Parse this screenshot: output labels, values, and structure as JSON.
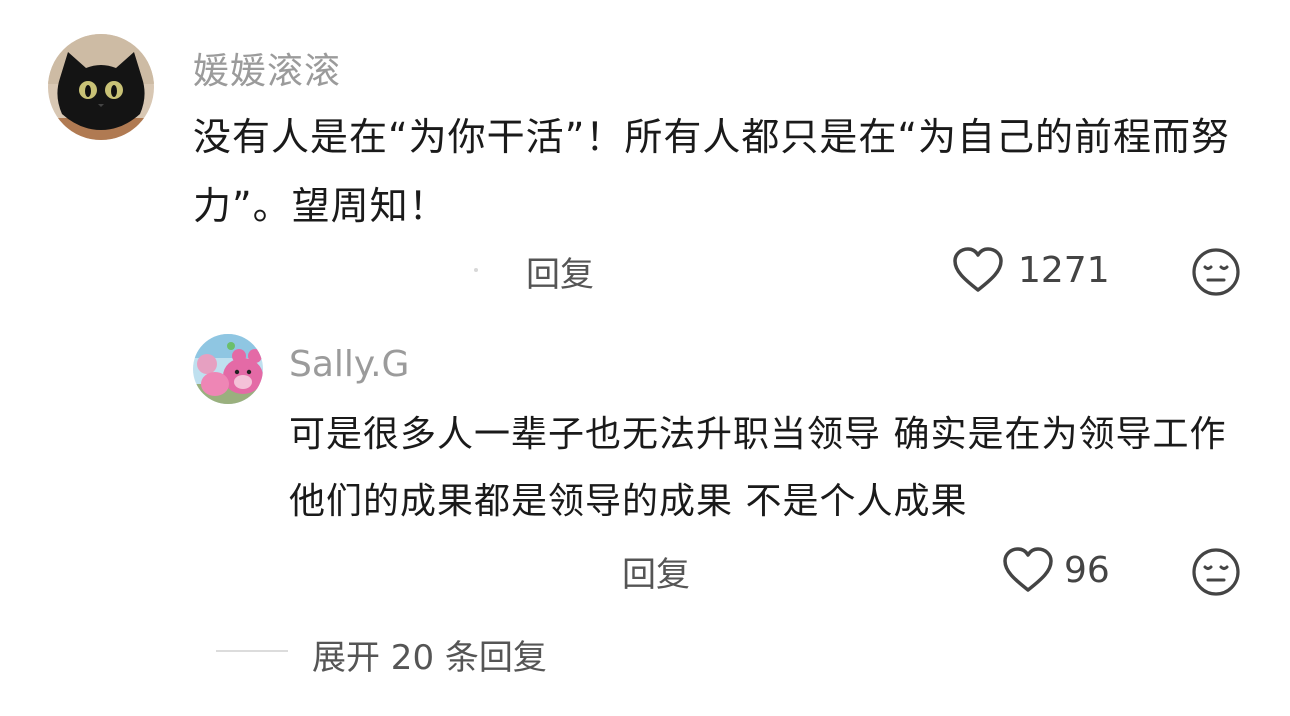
{
  "comment": {
    "username": "媛媛滚滚",
    "avatar": "black-cat-avatar",
    "text": "没有人是在“为你干活”！所有人都只是在“为自己的前程而努力”。望周知！",
    "reply_label": "回复",
    "like_count": "1271",
    "like_icon": "heart-outline-icon",
    "react_icon": "meh-face-icon"
  },
  "reply": {
    "username": "Sally.G",
    "avatar": "pink-bear-toy-avatar",
    "text": "可是很多人一辈子也无法升职当领导 确实是在为领导工作 他们的成果都是领导的成果 不是个人成果",
    "reply_label": "回复",
    "like_count": "96",
    "like_icon": "heart-outline-icon",
    "react_icon": "meh-face-icon"
  },
  "expand": {
    "label": "展开 20 条回复"
  },
  "colors": {
    "username": "#9b9b9b",
    "body_text": "#1a1a1a",
    "meta_text": "#555555",
    "divider": "#dcdcdc"
  }
}
